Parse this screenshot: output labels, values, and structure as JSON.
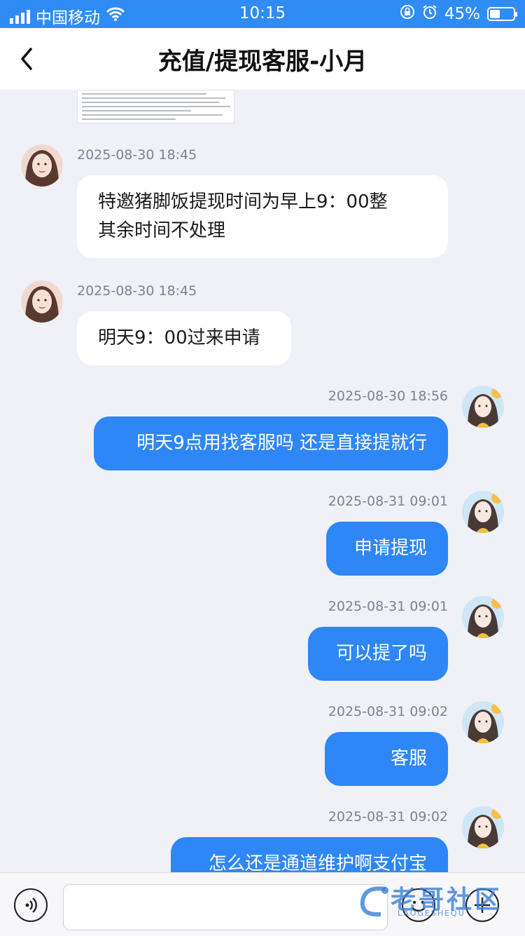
{
  "status_bar": {
    "carrier": "中国移动",
    "time": "10:15",
    "battery_percent_label": "45%",
    "battery_level": 0.45
  },
  "header": {
    "title": "充值/提现客服-小月"
  },
  "messages": [
    {
      "side": "in",
      "timestamp": "2025-08-30 18:45",
      "text": "特邀猪脚饭提现时间为早上9：00整\n其余时间不处理"
    },
    {
      "side": "in",
      "timestamp": "2025-08-30 18:45",
      "text": "明天9：00过来申请"
    },
    {
      "side": "out",
      "timestamp": "2025-08-30 18:56",
      "text": "明天9点用找客服吗 还是直接提就行"
    },
    {
      "side": "out",
      "timestamp": "2025-08-31 09:01",
      "text": "申请提现"
    },
    {
      "side": "out",
      "timestamp": "2025-08-31 09:01",
      "text": "可以提了吗"
    },
    {
      "side": "out",
      "timestamp": "2025-08-31 09:02",
      "text": "客服"
    },
    {
      "side": "out",
      "timestamp": "2025-08-31 09:02",
      "text": "怎么还是通道维护啊支付宝"
    }
  ],
  "input_bar": {
    "message_value": ""
  },
  "watermark": {
    "text": "老哥社区",
    "subtext": "LAOGESHEQU"
  },
  "icons": {
    "back": "chevron-left-icon",
    "voice": "voice-icon",
    "emoji": "emoji-icon",
    "plus": "plus-icon",
    "wifi": "wifi-icon",
    "alarm": "alarm-icon",
    "lock": "orientation-lock-icon"
  },
  "colors": {
    "status_bar": "#2f8cf5",
    "outgoing_bubble": "#2f86f6",
    "incoming_bubble": "#ffffff",
    "chat_background": "#eff1f7"
  }
}
